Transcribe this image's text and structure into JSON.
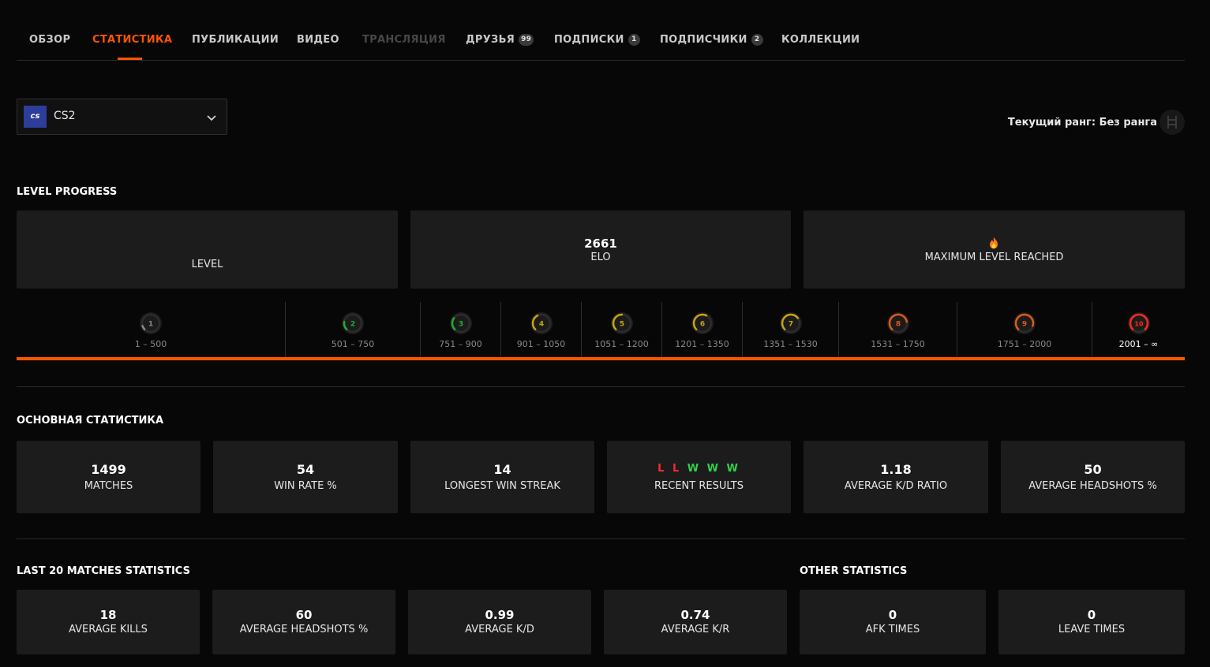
{
  "tabs": [
    {
      "label": "ОБЗОР",
      "state": "normal"
    },
    {
      "label": "СТАТИСТИКА",
      "state": "active"
    },
    {
      "label": "ПУБЛИКАЦИИ",
      "state": "normal"
    },
    {
      "label": "ВИДЕО",
      "state": "normal"
    },
    {
      "label": "ТРАНСЛЯЦИЯ",
      "state": "disabled"
    },
    {
      "label": "ДРУЗЬЯ",
      "badge": "99",
      "state": "normal"
    },
    {
      "label": "ПОДПИСКИ",
      "badge": "1",
      "state": "normal"
    },
    {
      "label": "ПОДПИСЧИКИ",
      "badge": "2",
      "state": "normal"
    },
    {
      "label": "КОЛЛЕКЦИИ",
      "state": "normal"
    }
  ],
  "game_select": {
    "logo_text": "cs",
    "name": "CS2",
    "icon": "chevron-down-icon"
  },
  "rank": {
    "text": "Текущий ранг: Без ранга",
    "icon": "rank-badge-icon"
  },
  "level_progress": {
    "title": "LEVEL PROGRESS",
    "level_card": {
      "label": "LEVEL"
    },
    "elo_card": {
      "value": "2661",
      "label": "ELO"
    },
    "max_card": {
      "icon": "fire-icon",
      "label": "MAXIMUM LEVEL REACHED"
    },
    "levels": [
      {
        "level": "1",
        "range": "1 – 500",
        "color": "#8a8a8a",
        "fill": 0.1
      },
      {
        "level": "2",
        "range": "501 – 750",
        "color": "#1fae34",
        "fill": 0.2
      },
      {
        "level": "3",
        "range": "751 – 900",
        "color": "#1fae34",
        "fill": 0.3
      },
      {
        "level": "4",
        "range": "901 – 1050",
        "color": "#c8a50a",
        "fill": 0.4
      },
      {
        "level": "5",
        "range": "1051 – 1200",
        "color": "#c8a50a",
        "fill": 0.5
      },
      {
        "level": "6",
        "range": "1201 – 1350",
        "color": "#c8a50a",
        "fill": 0.6
      },
      {
        "level": "7",
        "range": "1351 – 1530",
        "color": "#c8a50a",
        "fill": 0.7
      },
      {
        "level": "8",
        "range": "1531 – 1750",
        "color": "#e05a14",
        "fill": 0.8
      },
      {
        "level": "9",
        "range": "1751 – 2000",
        "color": "#e05a14",
        "fill": 0.9
      },
      {
        "level": "10",
        "range": "2001 – ∞",
        "color": "#ff2a1a",
        "fill": 1.0,
        "current": true
      }
    ],
    "progress_color": "#ff5500"
  },
  "main_stats": {
    "title": "ОСНОВНАЯ СТАТИСТИКА",
    "cards": [
      {
        "value": "1499",
        "label": "MATCHES"
      },
      {
        "value": "54",
        "label": "WIN RATE %"
      },
      {
        "value": "14",
        "label": "LONGEST WIN STREAK"
      },
      {
        "results": [
          "L",
          "L",
          "W",
          "W",
          "W"
        ],
        "label": "RECENT RESULTS"
      },
      {
        "value": "1.18",
        "label": "AVERAGE K/D RATIO"
      },
      {
        "value": "50",
        "label": "AVERAGE HEADSHOTS %"
      }
    ]
  },
  "last20": {
    "title": "LAST 20 MATCHES STATISTICS",
    "cards": [
      {
        "value": "18",
        "label": "AVERAGE KILLS"
      },
      {
        "value": "60",
        "label": "AVERAGE HEADSHOTS %"
      },
      {
        "value": "0.99",
        "label": "AVERAGE K/D"
      },
      {
        "value": "0.74",
        "label": "AVERAGE K/R"
      }
    ]
  },
  "other": {
    "title": "OTHER STATISTICS",
    "cards": [
      {
        "value": "0",
        "label": "AFK TIMES"
      },
      {
        "value": "0",
        "label": "LEAVE TIMES"
      }
    ]
  },
  "colors": {
    "accent": "#ff5500",
    "loss": "#ff2a2a",
    "win": "#32d14a"
  }
}
